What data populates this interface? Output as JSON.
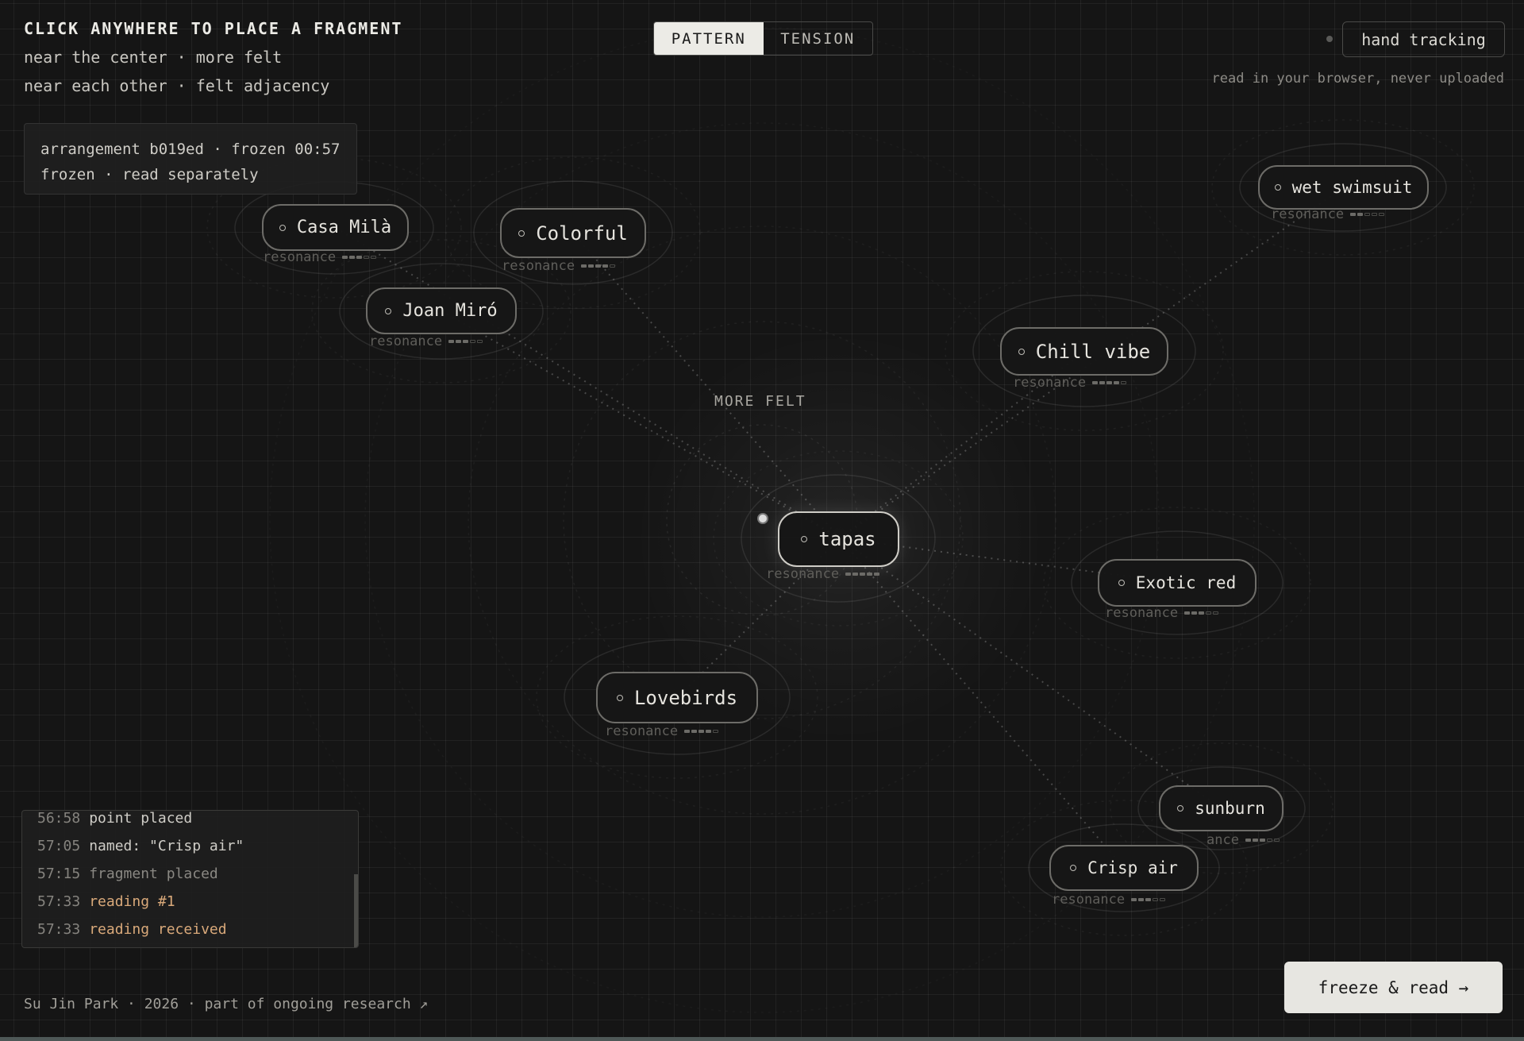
{
  "instructions": {
    "title": "CLICK ANYWHERE TO PLACE A FRAGMENT",
    "line1": "near the center · more felt",
    "line2": "near each other · felt adjacency"
  },
  "arrangement": {
    "line1": "arrangement b019ed · frozen 00:57",
    "line2": "frozen · read separately"
  },
  "mode_toggle": {
    "options": [
      "PATTERN",
      "TENSION"
    ],
    "active": "PATTERN"
  },
  "tracking": {
    "button_label": "hand tracking",
    "note": "read in your browser, never uploaded"
  },
  "axis_label": "MORE FELT",
  "fragments": [
    {
      "label": "Casa Milà",
      "resonance_label": "resonance",
      "resonance_level": 3,
      "resonance_max": 5
    },
    {
      "label": "Colorful",
      "resonance_label": "resonance",
      "resonance_level": 4,
      "resonance_max": 5
    },
    {
      "label": "Joan Miró",
      "resonance_label": "resonance",
      "resonance_level": 3,
      "resonance_max": 5
    },
    {
      "label": "wet swimsuit",
      "resonance_label": "resonance",
      "resonance_level": 2,
      "resonance_max": 5
    },
    {
      "label": "Chill vibe",
      "resonance_label": "resonance",
      "resonance_level": 4,
      "resonance_max": 5
    },
    {
      "label": "tapas",
      "resonance_label": "resonance",
      "resonance_level": 5,
      "resonance_max": 5
    },
    {
      "label": "Exotic red",
      "resonance_label": "resonance",
      "resonance_level": 3,
      "resonance_max": 5
    },
    {
      "label": "Lovebirds",
      "resonance_label": "resonance",
      "resonance_level": 4,
      "resonance_max": 5
    },
    {
      "label": "sunburn",
      "resonance_label": "ance",
      "resonance_level": 3,
      "resonance_max": 5
    },
    {
      "label": "Crisp air",
      "resonance_label": "resonance",
      "resonance_level": 3,
      "resonance_max": 5
    }
  ],
  "event_log": [
    {
      "time": "56:58",
      "message": "point placed",
      "style": "normal"
    },
    {
      "time": "57:05",
      "message": "named: \"Crisp air\"",
      "style": "normal"
    },
    {
      "time": "57:15",
      "message": "fragment placed",
      "style": "muted"
    },
    {
      "time": "57:33",
      "message": "reading #1",
      "style": "accent"
    },
    {
      "time": "57:33",
      "message": "reading received",
      "style": "accent"
    }
  ],
  "footer": {
    "credit": "Su Jin Park · 2026 · part of ongoing research ↗",
    "freeze_button": "freeze & read →"
  },
  "colors": {
    "background": "#151515",
    "accent_log": "#d9a97a",
    "button_light": "#e7e6e1"
  }
}
